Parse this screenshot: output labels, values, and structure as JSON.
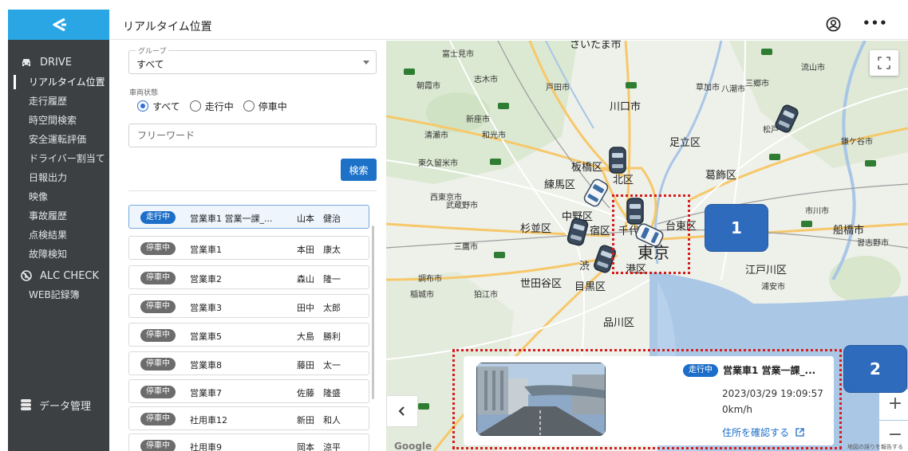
{
  "header": {
    "title": "リアルタイム位置"
  },
  "sidebar": {
    "section_drive": "DRIVE",
    "items": [
      {
        "label": "リアルタイム位置",
        "active": true
      },
      {
        "label": "走行履歴"
      },
      {
        "label": "時空間検索"
      },
      {
        "label": "安全運転評価"
      },
      {
        "label": "ドライバー割当て"
      },
      {
        "label": "日報出力"
      },
      {
        "label": "映像"
      },
      {
        "label": "事故履歴"
      },
      {
        "label": "点検結果"
      },
      {
        "label": "故障検知"
      }
    ],
    "section_alc": "ALC CHECK",
    "web_log": "WEB記録簿",
    "data_mgmt": "データ管理"
  },
  "filters": {
    "group_label": "グループ",
    "group_value": "すべて",
    "state_label": "車両状態",
    "radios": [
      {
        "label": "すべて",
        "checked": true
      },
      {
        "label": "走行中",
        "checked": false
      },
      {
        "label": "停車中",
        "checked": false
      }
    ],
    "freeword_placeholder": "フリーワード",
    "search_label": "検索"
  },
  "vehicles": [
    {
      "status": "走行中",
      "name": "営業車1 営業一課_...",
      "driver": "山本　健治",
      "selected": true
    },
    {
      "status": "停車中",
      "name": "営業車1",
      "driver": "本田　康太"
    },
    {
      "status": "停車中",
      "name": "営業車2",
      "driver": "森山　隆一"
    },
    {
      "status": "停車中",
      "name": "営業車3",
      "driver": "田中　太郎"
    },
    {
      "status": "停車中",
      "name": "営業車5",
      "driver": "大島　勝利"
    },
    {
      "status": "停車中",
      "name": "営業車8",
      "driver": "藤田　太一"
    },
    {
      "status": "停車中",
      "name": "営業車7",
      "driver": "佐藤　隆盛"
    },
    {
      "status": "停車中",
      "name": "社用車12",
      "driver": "新田　和人"
    },
    {
      "status": "停車中",
      "name": "社用車9",
      "driver": "岡本　涼平"
    }
  ],
  "map": {
    "labels": {
      "saitama": "さいたま市",
      "fujimino": "富士見市",
      "shiki": "志木市",
      "kawaguchi": "川口市",
      "soka": "草加市",
      "misato": "三郷市",
      "nagareyama": "流山市",
      "matsudo": "松戸",
      "kamagaya": "鎌ケ谷市",
      "adachi": "足立区",
      "katsushika": "葛飾区",
      "edogawa": "江戸川区",
      "itabashi": "板橋区",
      "kita": "北区",
      "nerima": "練馬区",
      "nakano": "中野区",
      "suginami": "杉並区",
      "shinjuku": "宿区",
      "chiyoda": "千代",
      "taito": "台東区",
      "tokyo": "東京",
      "minato": "港区",
      "shibuya": "渋",
      "setagaya": "世田谷区",
      "meguro": "目黒区",
      "shinagawa": "品川区",
      "funabashi": "船橋市",
      "ichikawa": "市川市",
      "urayasu": "浦安市",
      "asaka": "朝霞市",
      "niiza": "新座市",
      "kiyose": "清瀬市",
      "higashikurume": "東久留米市",
      "nishitokyo": "西東京市",
      "musashino": "武蔵野市",
      "mitaka": "三鷹市",
      "chofu": "調布市",
      "komae": "狛江市",
      "inagi": "稲城市",
      "wako": "和光市",
      "toda": "戸田市",
      "yashio": "八潮市",
      "narashino": "習志野市"
    },
    "google": "Google",
    "attribution": "地図の誤りを報告する"
  },
  "callouts": {
    "one": "1",
    "two": "2"
  },
  "popup": {
    "status": "走行中",
    "vehicle": "営業車1 営業一課_...",
    "time": "2023/03/29 19:09:57",
    "speed": "0km/h",
    "link": "住所を確認する"
  },
  "colors": {
    "accent": "#1d6ec8",
    "sidebar": "#3c4043",
    "logo": "#29a6e3",
    "callout": "#d61c1c",
    "badge_stop": "#6c6c6c"
  }
}
